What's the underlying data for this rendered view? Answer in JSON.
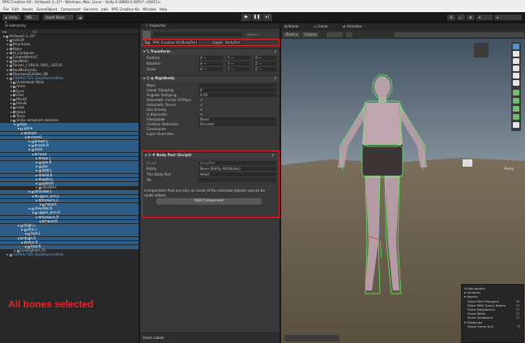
{
  "window": {
    "title": "RPG Creation Kit - VirHaxel(-1,-2)* - Windows, Mac, Linux - Unity 6 (6000.0.20f1)* <DX11>"
  },
  "menu": [
    "File",
    "Edit",
    "Assets",
    "GameObject",
    "Component",
    "Services",
    "Jobs",
    "RPG Creation Kit",
    "Window",
    "Help"
  ],
  "toolbar": {
    "account": "Unity 6",
    "ms": "MS",
    "asset_store": "Asset Store"
  },
  "hierarchy": {
    "tab": "Hierarchy",
    "search_placeholder": "All",
    "annotation": "All bones selected",
    "rows": [
      {
        "t": "VirHaxel(-1,-2)*",
        "d": 0,
        "s": false
      },
      {
        "t": "Cells/It",
        "d": 1,
        "s": false
      },
      {
        "t": "Structures",
        "d": 1,
        "s": false
      },
      {
        "t": "Paths",
        "d": 1,
        "s": false
      },
      {
        "t": "AI_Container",
        "d": 1,
        "s": false
      },
      {
        "t": "CreatedItemsT",
        "d": 1,
        "s": false
      },
      {
        "t": "NavMesh",
        "d": 1,
        "s": false
      },
      {
        "t": "Terrain_(-100,0,-100)_-320,0)",
        "d": 1,
        "s": false
      },
      {
        "t": "NavMeshLinks",
        "d": 1,
        "s": false
      },
      {
        "t": "DoorsandCollider_06",
        "d": 1,
        "s": false
      },
      {
        "t": "CHARACTER_BaseHumanMale",
        "d": 1,
        "s": false,
        "b": true
      },
      {
        "t": "Underwear Male",
        "d": 2,
        "s": false
      },
      {
        "t": "Arms",
        "d": 2,
        "s": false
      },
      {
        "t": "Eyes",
        "d": 2,
        "s": false
      },
      {
        "t": "Feet",
        "d": 2,
        "s": false
      },
      {
        "t": "Mouth",
        "d": 2,
        "s": false
      },
      {
        "t": "Hands",
        "d": 2,
        "s": false
      },
      {
        "t": "Legs",
        "d": 2,
        "s": false
      },
      {
        "t": "Head",
        "d": 2,
        "s": false
      },
      {
        "t": "Torso",
        "d": 2,
        "s": false
      },
      {
        "t": "Unity compliant skeleton",
        "d": 2,
        "s": false
      },
      {
        "t": "hips",
        "d": 3,
        "s": true
      },
      {
        "t": "spine",
        "d": 4,
        "s": true
      },
      {
        "t": "chest",
        "d": 5,
        "s": true
      },
      {
        "t": "chest1",
        "d": 6,
        "s": true
      },
      {
        "t": "breast.L",
        "d": 7,
        "s": true
      },
      {
        "t": "breast.R",
        "d": 7,
        "s": true
      },
      {
        "t": "neck",
        "d": 7,
        "s": true
      },
      {
        "t": "head",
        "d": 8,
        "s": true
      },
      {
        "t": "eye.L",
        "d": 9,
        "s": true
      },
      {
        "t": "eye.R",
        "d": 9,
        "s": true
      },
      {
        "t": "jaw",
        "d": 9,
        "s": true
      },
      {
        "t": "lolid.L",
        "d": 9,
        "s": true
      },
      {
        "t": "lolid.R",
        "d": 9,
        "s": true
      },
      {
        "t": "uplid.L",
        "d": 9,
        "s": true
      },
      {
        "t": "uplid.R",
        "d": 9,
        "s": true
      },
      {
        "t": "HeadPos",
        "d": 9,
        "s": false
      },
      {
        "t": "shoulder.L",
        "d": 7,
        "s": true
      },
      {
        "t": "upper_arm.L",
        "d": 8,
        "s": true
      },
      {
        "t": "forearm.L",
        "d": 9,
        "s": true
      },
      {
        "t": "hand.L",
        "d": 10,
        "s": true
      },
      {
        "t": "shoulder.R",
        "d": 7,
        "s": true
      },
      {
        "t": "upper_arm.R",
        "d": 8,
        "s": true
      },
      {
        "t": "forearm.R",
        "d": 9,
        "s": true
      },
      {
        "t": "hand.R",
        "d": 10,
        "s": true
      },
      {
        "t": "thigh.L",
        "d": 4,
        "s": true
      },
      {
        "t": "shin.L",
        "d": 5,
        "s": true
      },
      {
        "t": "foot.L",
        "d": 6,
        "s": true
      },
      {
        "t": "thigh.R",
        "d": 4,
        "s": true
      },
      {
        "t": "shin.R",
        "d": 5,
        "s": true
      },
      {
        "t": "foot.R",
        "d": 6,
        "s": true
      },
      {
        "t": "LeviHighest_01",
        "d": 3,
        "s": false
      },
      {
        "t": "CHARACTER_BaseHumanMale",
        "d": 1,
        "s": false,
        "b": true
      }
    ]
  },
  "inspector": {
    "tab": "Inspector",
    "tag_label": "Tag",
    "tag_value": "RPG Creation Kit/BodyPart",
    "layer_label": "Layer",
    "layer_value": "BodyPart",
    "transform": {
      "title": "Transform",
      "position": "Position",
      "rotation": "Rotation",
      "scale": "Scale",
      "dash": "—"
    },
    "rigidbody": {
      "title": "Rigidbody",
      "props": [
        [
          "Mass",
          ""
        ],
        [
          "Linear Damping",
          "0"
        ],
        [
          "Angular Damping",
          "0.05"
        ],
        [
          "Automatic Center Of Mass",
          "✔"
        ],
        [
          "Automatic Tensor",
          "✔"
        ],
        [
          "Use Gravity",
          "✔"
        ],
        [
          "Is Kinematic",
          "✔"
        ],
        [
          "Interpolate",
          "None"
        ],
        [
          "Collision Detection",
          "Discrete"
        ],
        [
          "Constraints",
          ""
        ],
        [
          "Layer Overrides",
          ""
        ]
      ]
    },
    "bodypart": {
      "title": "Body Part (Script)",
      "props": [
        [
          "Script",
          "BodyPart"
        ],
        [
          "Entity",
          "None (Entity Attributes)"
        ],
        [
          "This Body Part",
          "Head"
        ],
        [
          "Rb",
          ""
        ]
      ],
      "warning": "Components that are only on some of the selected objects cannot be multi-edited.",
      "add_component": "Add Component"
    },
    "asset_labels": "Asset Labels"
  },
  "scene": {
    "tabs": [
      "Scene",
      "Game",
      "Animator"
    ],
    "pivot": "Pivot",
    "local": "Local",
    "persp": "Persp",
    "overlay": {
      "header": "AI Navigation",
      "surfaces": "Surfaces",
      "agents": "Agents",
      "items": [
        "Show Path Polygons",
        "Show Path Query Nodes",
        "Show Neighbours",
        "Show Walls",
        "Show Avoidance"
      ],
      "obstacles": "Obstacles",
      "carve": "Show Carve Hull"
    }
  }
}
